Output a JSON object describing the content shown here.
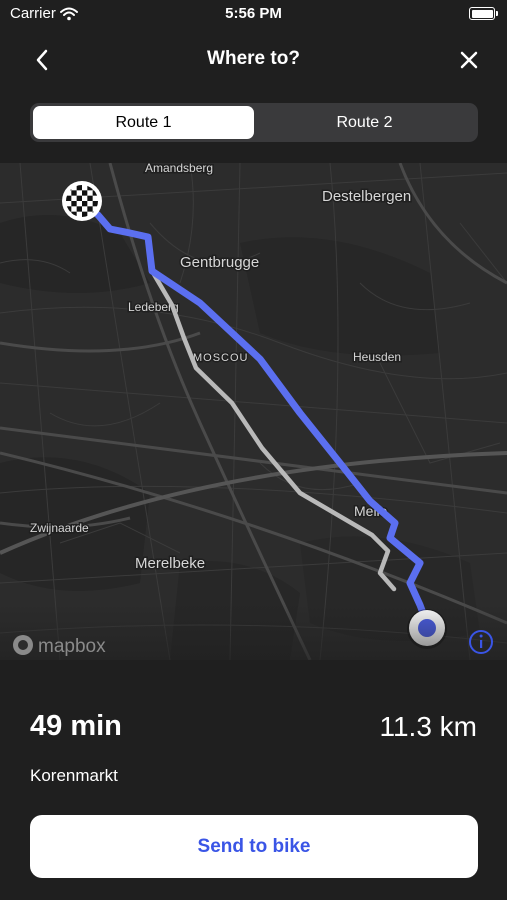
{
  "status_bar": {
    "carrier": "Carrier",
    "time": "5:56 PM"
  },
  "nav": {
    "title": "Where to?",
    "back_icon": "chevron-left-icon",
    "close_icon": "close-icon"
  },
  "route_tabs": {
    "items": [
      {
        "label": "Route 1",
        "selected": true
      },
      {
        "label": "Route 2",
        "selected": false
      }
    ]
  },
  "map": {
    "place_labels": [
      "Amandsberg",
      "Destelbergen",
      "Gentbrugge",
      "Ledeberg",
      "MOSCOU",
      "Heusden",
      "Melle",
      "Zwijnaarde",
      "Merelbeke"
    ],
    "attribution": "mapbox",
    "colors": {
      "active_route": "#5b6ff0",
      "alternate_route": "#b9b9b9",
      "map_background": "#2c2c2c"
    }
  },
  "summary": {
    "duration": "49 min",
    "distance": "11.3 km",
    "destination": "Korenmarkt"
  },
  "action": {
    "send_label": "Send to bike",
    "color": "#3a55e6"
  }
}
